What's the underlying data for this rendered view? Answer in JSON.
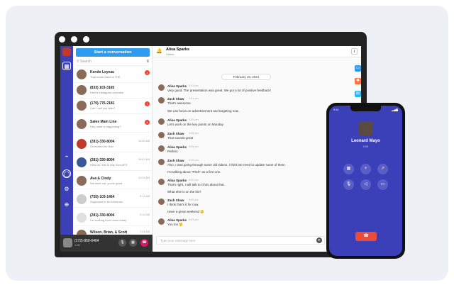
{
  "chat_list": {
    "start_button": "Start a conversation",
    "search_placeholder": "Search",
    "contacts": [
      {
        "name": "Kendo Leyeau",
        "preview": "That music band is THE",
        "time": "",
        "badge": "1"
      },
      {
        "name": "(833) 103-3165",
        "preview": "Here's instagram overview",
        "time": "",
        "badge": ""
      },
      {
        "name": "(170)-776-2181",
        "preview": "Can I call you later?",
        "time": "",
        "badge": "1"
      },
      {
        "name": "Sales Main Line",
        "preview": "Hey, what is happening?",
        "time": "",
        "badge": "4"
      },
      {
        "name": "(281)-330-8004",
        "preview": "So excited for this!",
        "time": "10:30 AM",
        "badge": ""
      },
      {
        "name": "(281)-330-8004",
        "preview": "Hello sir, this is Lilly from AFS",
        "time": "10:41 AM",
        "badge": ""
      },
      {
        "name": "Ava & Cindy",
        "preview": "We went out, you're good",
        "time": "10:11 AM",
        "badge": ""
      },
      {
        "name": "(755)-103-1464",
        "preview": "Supposed to be tomorrow.",
        "time": "9:12 AM",
        "badge": ""
      },
      {
        "name": "(281)-330-8004",
        "preview": "I'm working from home today",
        "time": "9:12 AM",
        "badge": ""
      },
      {
        "name": "Wilson, Brian, & Scott",
        "preview": "",
        "time": "7:41 AM",
        "badge": ""
      }
    ]
  },
  "call_bar": {
    "number": "(172)-950-6464",
    "duration": "1:32"
  },
  "chat": {
    "contact_name": "Alisa Sparks",
    "status": "Online",
    "date_divider": "February 18, 2021",
    "input_placeholder": "Type your message here",
    "messages": [
      {
        "name": "Alisa Sparks",
        "time": "3:01 pm",
        "text": "Very good. The presentation was great. We got a lot of positive feedback!"
      },
      {
        "name": "Zach Shaw",
        "time": "3:01 pm",
        "text": "That's awesome."
      },
      {
        "name": "",
        "time": "",
        "text": "We can focus on advertisement and targeting now."
      },
      {
        "name": "Alisa Sparks",
        "time": "3:05 pm",
        "text": "Let's work on the key points on Monday"
      },
      {
        "name": "Zach Shaw",
        "time": "3:05 pm",
        "text": "That sounds great"
      },
      {
        "name": "Alisa Sparks",
        "time": "3:05 pm",
        "text": "Perfect."
      },
      {
        "name": "Zach Shaw",
        "time": "4:15 pm",
        "text": "Also, I was going through some old videos. I think we need to update some of them."
      },
      {
        "name": "",
        "time": "",
        "text": "I'm talking about \"Pitch\" as a first one."
      },
      {
        "name": "Alisa Sparks",
        "time": "4:20 pm",
        "text": "That's right, I will talk to Chris about that."
      },
      {
        "name": "",
        "time": "",
        "text": "What else is on the list?"
      },
      {
        "name": "Zach Shaw",
        "time": "5:00 pm",
        "text": "I think that's it for now."
      },
      {
        "name": "",
        "time": "",
        "text": "Have a great weekend 🙂"
      },
      {
        "name": "Alisa Sparks",
        "time": "5:03 pm",
        "text": "You too 🙂"
      }
    ]
  },
  "phone": {
    "time": "9:41",
    "caller_name": "Leonard Mayo",
    "call_status": "0:09",
    "hangup_icon": "phone-hangup-icon"
  }
}
